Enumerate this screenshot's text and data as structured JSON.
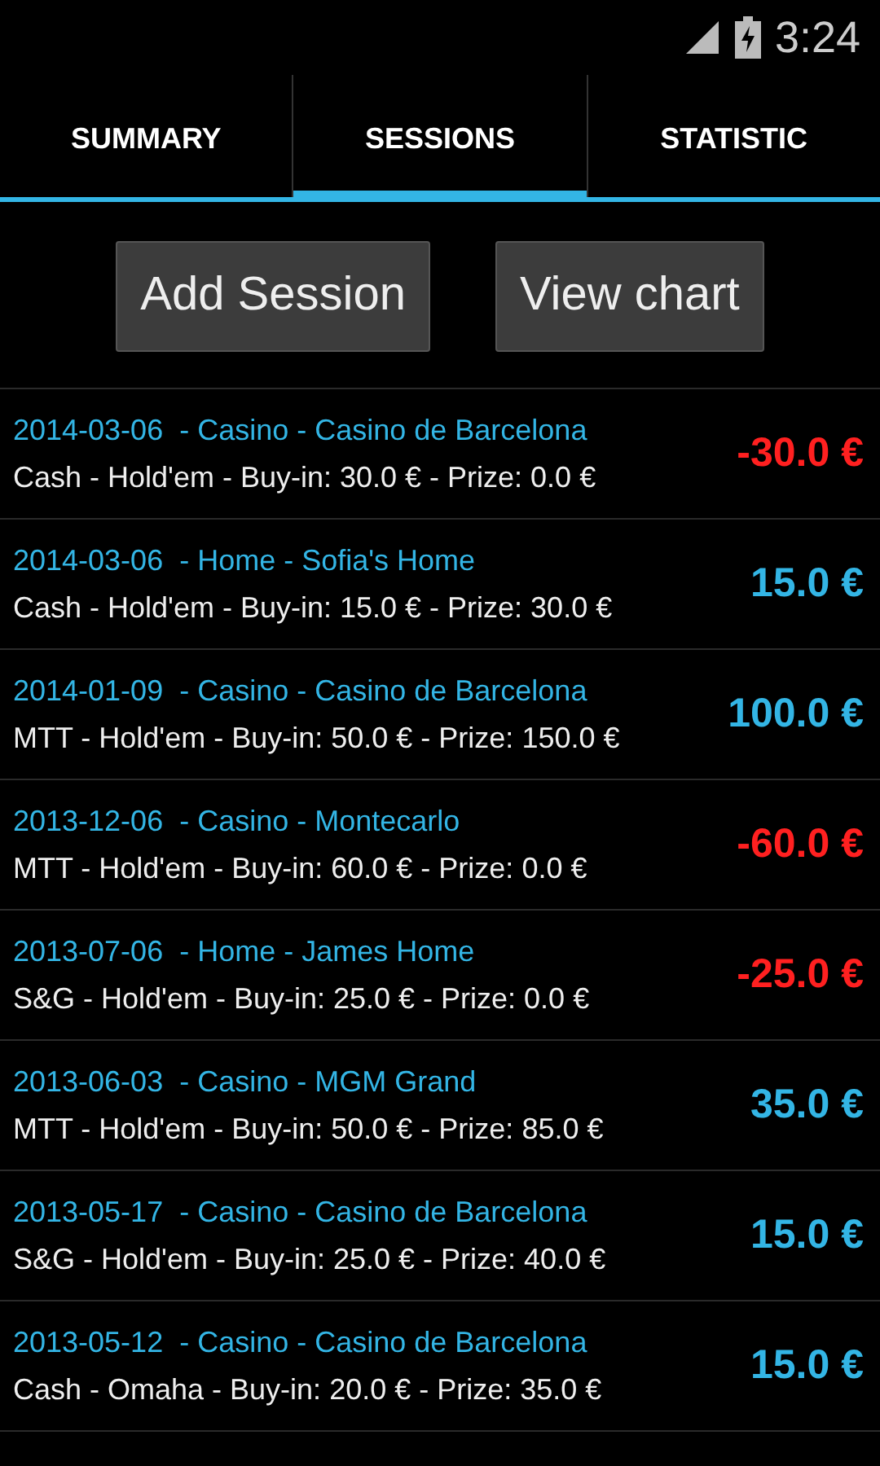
{
  "status_bar": {
    "time": "3:24"
  },
  "tabs": [
    {
      "label": "SUMMARY",
      "selected": false
    },
    {
      "label": "SESSIONS",
      "selected": true
    },
    {
      "label": "STATISTIC",
      "selected": false
    }
  ],
  "buttons": [
    "Add Session",
    "View chart"
  ],
  "sessions": [
    {
      "title": "2014-03-06  - Casino - Casino de Barcelona",
      "details": "Cash - Hold'em - Buy-in: 30.0 € - Prize: 0.0 €",
      "result": "-30.0 €",
      "kind": "loss"
    },
    {
      "title": "2014-03-06  - Home - Sofia's Home",
      "details": "Cash - Hold'em - Buy-in: 15.0 € - Prize: 30.0 €",
      "result": "15.0 €",
      "kind": "gain"
    },
    {
      "title": "2014-01-09  - Casino - Casino de Barcelona",
      "details": "MTT - Hold'em - Buy-in: 50.0 € - Prize: 150.0 €",
      "result": "100.0 €",
      "kind": "gain"
    },
    {
      "title": "2013-12-06  - Casino - Montecarlo",
      "details": "MTT - Hold'em - Buy-in: 60.0 € - Prize: 0.0 €",
      "result": "-60.0 €",
      "kind": "loss"
    },
    {
      "title": "2013-07-06  - Home - James Home",
      "details": "S&G - Hold'em - Buy-in: 25.0 € - Prize: 0.0 €",
      "result": "-25.0 €",
      "kind": "loss"
    },
    {
      "title": "2013-06-03  - Casino - MGM Grand",
      "details": "MTT - Hold'em - Buy-in: 50.0 € - Prize: 85.0 €",
      "result": "35.0 €",
      "kind": "gain"
    },
    {
      "title": "2013-05-17  - Casino - Casino de Barcelona",
      "details": "S&G - Hold'em - Buy-in: 25.0 € - Prize: 40.0 €",
      "result": "15.0 €",
      "kind": "gain"
    },
    {
      "title": "2013-05-12  - Casino - Casino de Barcelona",
      "details": "Cash - Omaha - Buy-in: 20.0 € - Prize: 35.0 €",
      "result": "15.0 €",
      "kind": "gain"
    }
  ]
}
